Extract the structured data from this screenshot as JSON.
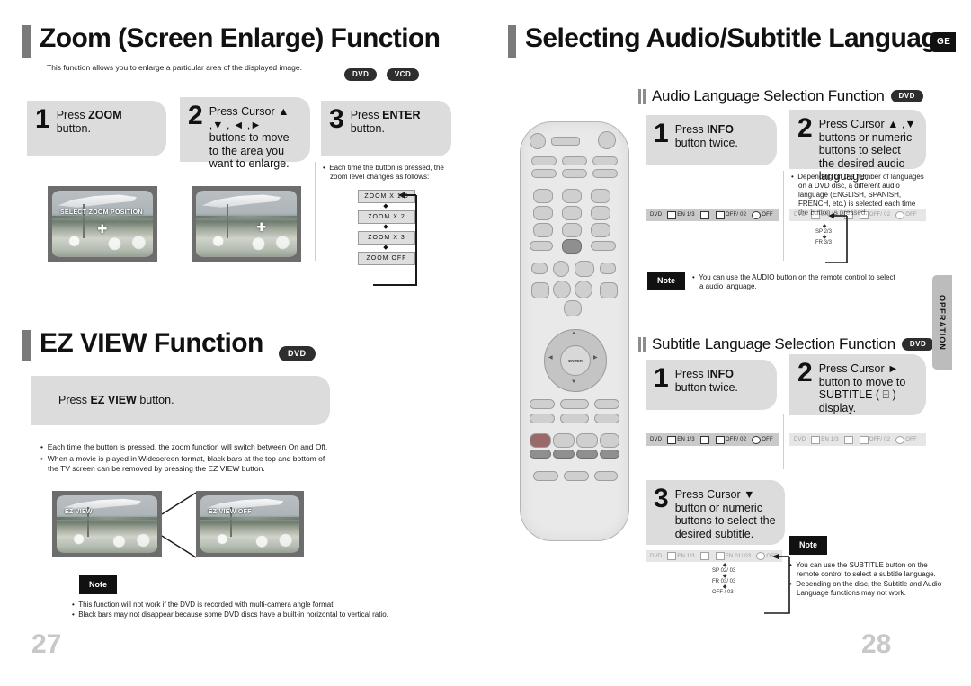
{
  "left_page": {
    "number": "27",
    "section1": {
      "title": "Zoom (Screen Enlarge) Function",
      "description": "This function allows you to enlarge a particular area of the displayed image.",
      "badges": [
        "DVD",
        "VCD"
      ],
      "steps": [
        {
          "num": "1",
          "text_parts": [
            "Press ",
            "ZOOM",
            " button."
          ]
        },
        {
          "num": "2",
          "text_parts": [
            "Press Cursor ▲ ,▼ , ◄ ,► buttons to move to the area you want to enlarge."
          ]
        },
        {
          "num": "3",
          "text_parts": [
            "Press ",
            "ENTER",
            " button."
          ]
        }
      ],
      "step3_note": "Each time the button is pressed, the zoom level changes as follows:",
      "tv1_label": "SELECT ZOOM POSITION",
      "zoom_flow": [
        "ZOOM X 1.5",
        "ZOOM X 2",
        "ZOOM X 3",
        "ZOOM OFF"
      ]
    },
    "section2": {
      "title": "EZ VIEW Function",
      "badge": "DVD",
      "instruction_parts": [
        "Press ",
        "EZ VIEW",
        " button."
      ],
      "bullets": [
        "Each time the button is pressed, the zoom function will switch between On and Off.",
        "When a movie is played in Widescreen format, black bars at the top and bottom of the TV screen can be removed by pressing the EZ VIEW button."
      ],
      "tv_labels": [
        "EZ VIEW",
        "EZ VIEW OFF"
      ],
      "note_label": "Note",
      "notes": [
        "This function will not work if the DVD is recorded with multi-camera angle format.",
        "Black bars may not disappear because some DVD discs have a built-in horizontal to vertical ratio."
      ]
    }
  },
  "right_page": {
    "number": "28",
    "title": "Selecting Audio/Subtitle Language",
    "corner_badge": "GE",
    "side_tab": "OPERATION",
    "audio_section": {
      "heading": "Audio Language Selection Function",
      "badge": "DVD",
      "steps": [
        {
          "num": "1",
          "text_parts": [
            "Press ",
            "INFO",
            " button twice."
          ]
        },
        {
          "num": "2",
          "text_parts": [
            "Press Cursor ▲ ,▼ buttons or numeric buttons to select the desired audio language."
          ]
        }
      ],
      "step2_note": "Depending on the number of languages on a DVD disc, a different audio language (ENGLISH, SPANISH, FRENCH, etc.) is selected each time the button is pressed.",
      "osd_bar": [
        "DVD",
        "EN 1/3",
        "",
        "OFF/ 02",
        "OFF"
      ],
      "language_flow": [
        "EN 1/3",
        "SP 2/3",
        "FR 3/3"
      ],
      "note_label": "Note",
      "notes": [
        "You can use the AUDIO button on the remote control to select a audio language."
      ]
    },
    "subtitle_section": {
      "heading": "Subtitle Language Selection Function",
      "badge": "DVD",
      "steps": [
        {
          "num": "1",
          "text_parts": [
            "Press ",
            "INFO",
            " button twice."
          ]
        },
        {
          "num": "2",
          "text_parts": [
            "Press Cursor ► button to move to SUBTITLE ( ⌸ ) display."
          ]
        },
        {
          "num": "3",
          "text_parts": [
            "Press Cursor ▼ button or numeric buttons to select the desired subtitle."
          ]
        }
      ],
      "osd_bar": [
        "DVD",
        "EN 1/3",
        "",
        "OFF/ 02",
        "OFF"
      ],
      "subtitle_flow": [
        "EN 01/ 03",
        "SP 02/ 03",
        "FR 03/ 03",
        "OFF / 03"
      ],
      "note_label": "Note",
      "notes": [
        "You can use the SUBTITLE button on the remote control to select a subtitle language.",
        "Depending on the disc, the Subtitle and Audio Language functions may not work."
      ]
    }
  }
}
